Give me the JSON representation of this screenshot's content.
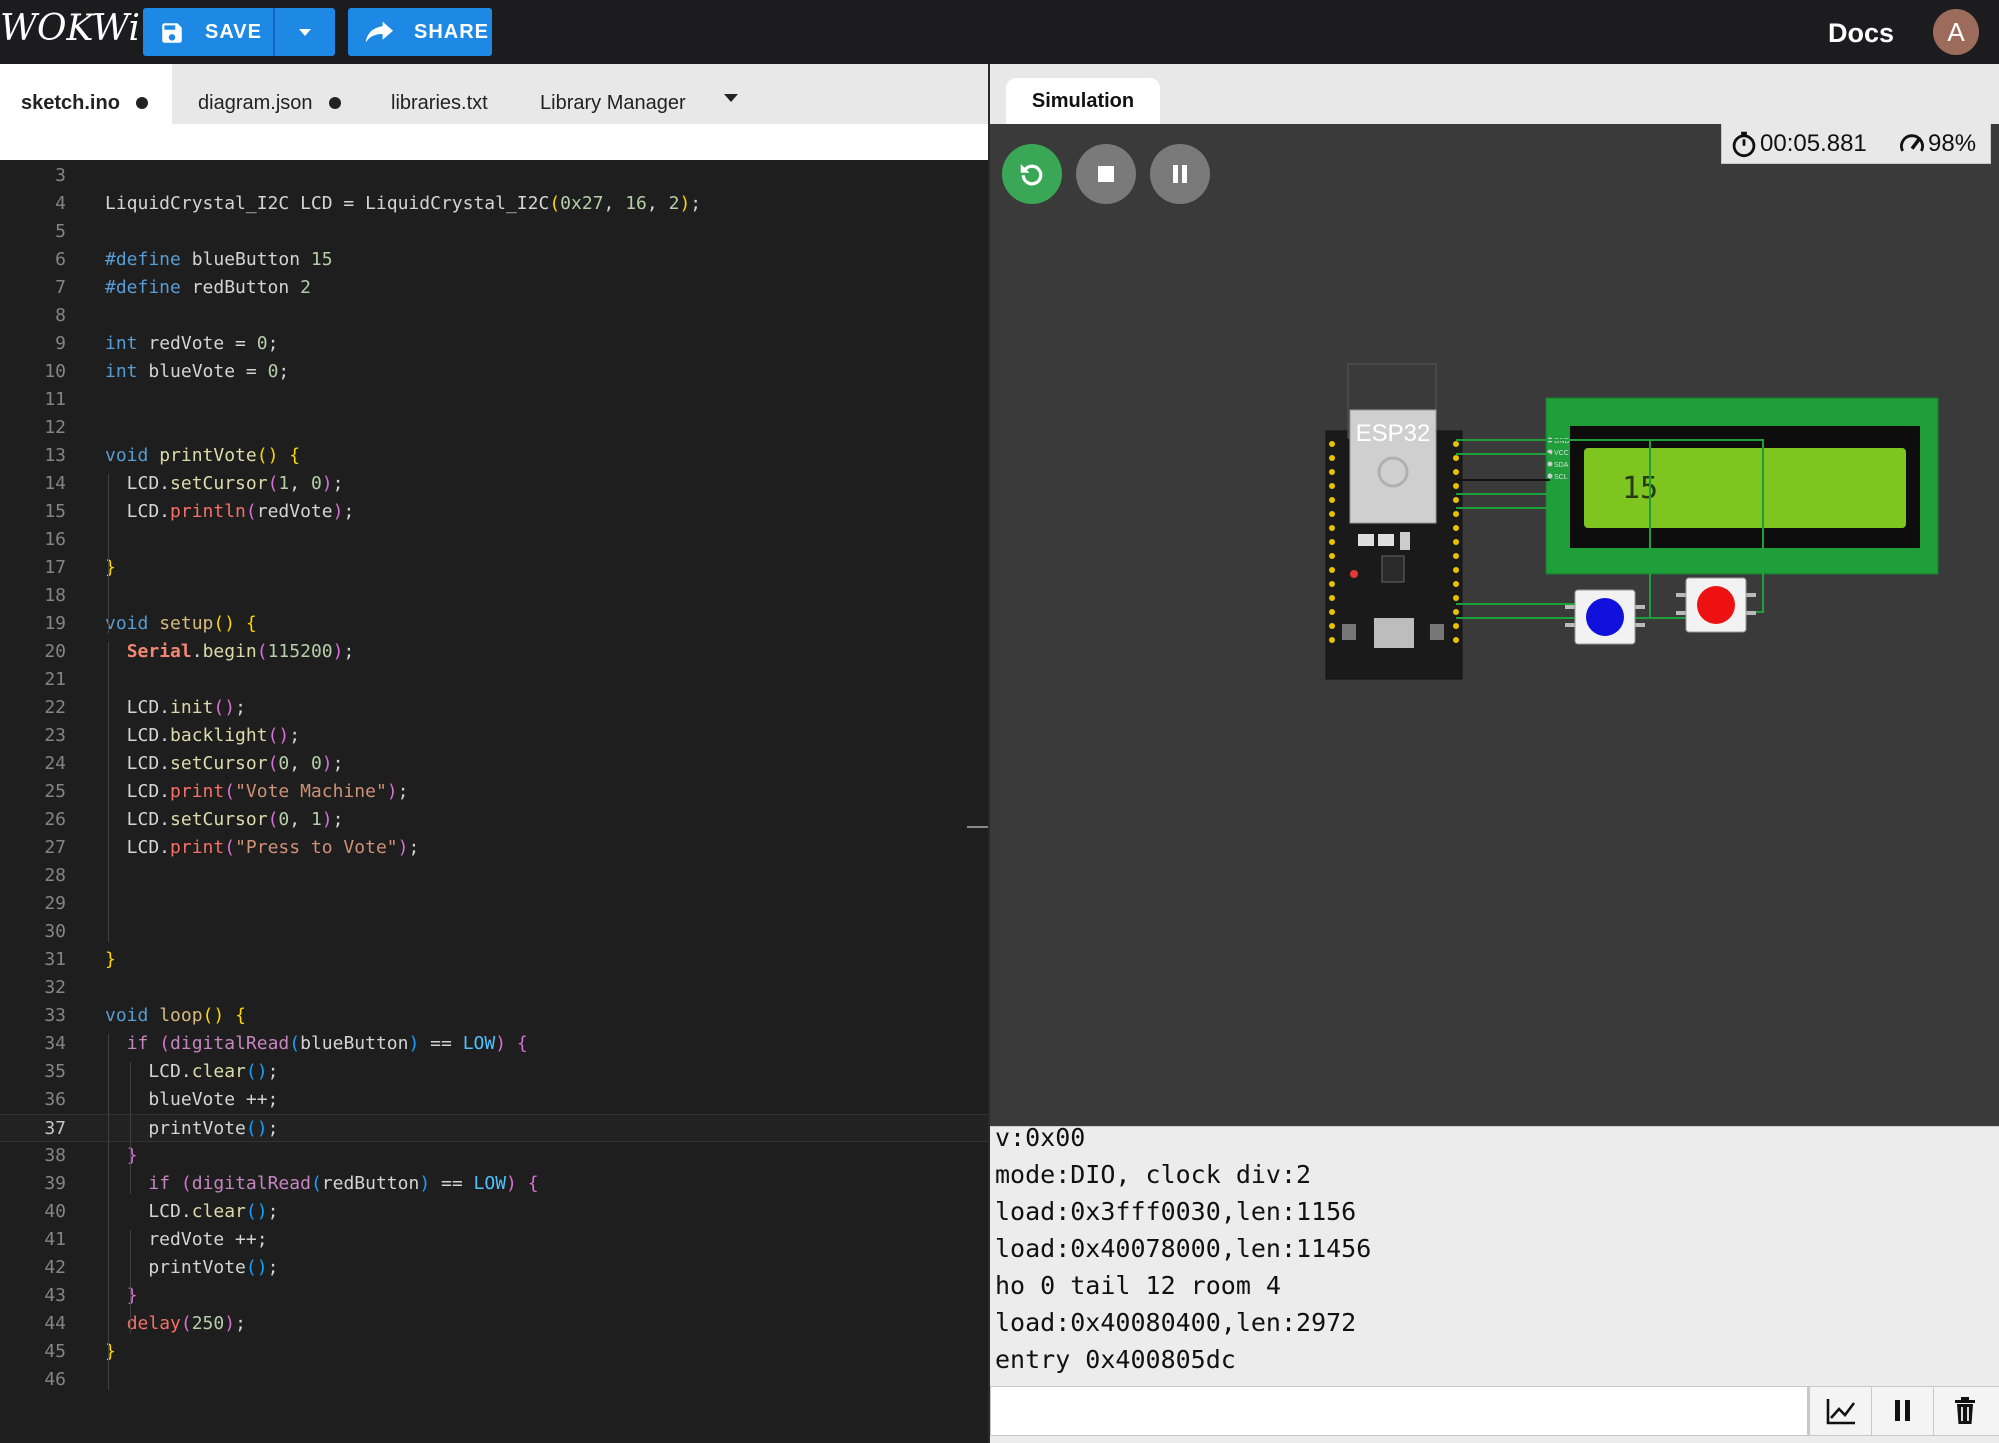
{
  "header": {
    "logo": "WOKWi",
    "save_label": "SAVE",
    "share_label": "SHARE",
    "docs_label": "Docs",
    "avatar_letter": "A"
  },
  "editor": {
    "tabs": [
      {
        "label": "sketch.ino",
        "modified": true,
        "active": true
      },
      {
        "label": "diagram.json",
        "modified": true,
        "active": false
      },
      {
        "label": "libraries.txt",
        "modified": false,
        "active": false
      },
      {
        "label": "Library Manager",
        "modified": false,
        "active": false
      }
    ],
    "active_line": 37,
    "lines": [
      {
        "n": "3",
        "tokens": [
          [
            "",
            ""
          ]
        ]
      },
      {
        "n": "4",
        "tokens": [
          [
            "LiquidCrystal_I2C LCD = LiquidCrystal_I2C",
            ""
          ],
          [
            "(",
            "brk"
          ],
          [
            "0x27",
            "num"
          ],
          [
            ", ",
            ""
          ],
          [
            "16",
            "num"
          ],
          [
            ", ",
            ""
          ],
          [
            "2",
            "num"
          ],
          [
            ")",
            "brk"
          ],
          [
            ";",
            ""
          ]
        ]
      },
      {
        "n": "5",
        "tokens": [
          [
            "",
            ""
          ]
        ]
      },
      {
        "n": "6",
        "tokens": [
          [
            "#define ",
            "kw"
          ],
          [
            "blueButton ",
            ""
          ],
          [
            "15",
            "num"
          ]
        ]
      },
      {
        "n": "7",
        "tokens": [
          [
            "#define ",
            "kw"
          ],
          [
            "redButton ",
            ""
          ],
          [
            "2",
            "num"
          ]
        ]
      },
      {
        "n": "8",
        "tokens": [
          [
            "",
            ""
          ]
        ]
      },
      {
        "n": "9",
        "tokens": [
          [
            "int ",
            "kw"
          ],
          [
            "redVote = ",
            ""
          ],
          [
            "0",
            "num"
          ],
          [
            ";",
            ""
          ]
        ]
      },
      {
        "n": "10",
        "tokens": [
          [
            "int ",
            "kw"
          ],
          [
            "blueVote = ",
            ""
          ],
          [
            "0",
            "num"
          ],
          [
            ";",
            ""
          ]
        ]
      },
      {
        "n": "11",
        "tokens": [
          [
            "",
            ""
          ]
        ]
      },
      {
        "n": "12",
        "tokens": [
          [
            "",
            ""
          ]
        ]
      },
      {
        "n": "13",
        "tokens": [
          [
            "void ",
            "kw"
          ],
          [
            "printVote",
            "fn"
          ],
          [
            "()",
            "brk"
          ],
          [
            " ",
            ""
          ],
          [
            "{",
            "brk"
          ]
        ]
      },
      {
        "n": "14",
        "tokens": [
          [
            "  LCD.",
            ""
          ],
          [
            "setCursor",
            "fn"
          ],
          [
            "(",
            "brk2"
          ],
          [
            "1",
            "num"
          ],
          [
            ", ",
            ""
          ],
          [
            "0",
            "num"
          ],
          [
            ")",
            "brk2"
          ],
          [
            ";",
            ""
          ]
        ]
      },
      {
        "n": "15",
        "tokens": [
          [
            "  LCD.",
            ""
          ],
          [
            "println",
            "print"
          ],
          [
            "(",
            "brk2"
          ],
          [
            "redVote",
            ""
          ],
          [
            ")",
            "brk2"
          ],
          [
            ";",
            ""
          ]
        ]
      },
      {
        "n": "16",
        "tokens": [
          [
            "",
            ""
          ]
        ]
      },
      {
        "n": "17",
        "tokens": [
          [
            "}",
            "brk"
          ]
        ]
      },
      {
        "n": "18",
        "tokens": [
          [
            "",
            ""
          ]
        ]
      },
      {
        "n": "19",
        "tokens": [
          [
            "void ",
            "kw"
          ],
          [
            "setup",
            "setup"
          ],
          [
            "()",
            "brk"
          ],
          [
            " ",
            ""
          ],
          [
            "{",
            "brk"
          ]
        ]
      },
      {
        "n": "20",
        "tokens": [
          [
            "  ",
            ""
          ],
          [
            "Serial",
            "serial"
          ],
          [
            ".",
            ""
          ],
          [
            "begin",
            "fn"
          ],
          [
            "(",
            "brk2"
          ],
          [
            "115200",
            "num"
          ],
          [
            ")",
            "brk2"
          ],
          [
            ";",
            ""
          ]
        ]
      },
      {
        "n": "21",
        "tokens": [
          [
            "",
            ""
          ]
        ]
      },
      {
        "n": "22",
        "tokens": [
          [
            "  LCD.",
            ""
          ],
          [
            "init",
            "fn"
          ],
          [
            "()",
            "brk2"
          ],
          [
            ";",
            ""
          ]
        ]
      },
      {
        "n": "23",
        "tokens": [
          [
            "  LCD.",
            ""
          ],
          [
            "backlight",
            "fn"
          ],
          [
            "()",
            "brk2"
          ],
          [
            ";",
            ""
          ]
        ]
      },
      {
        "n": "24",
        "tokens": [
          [
            "  LCD.",
            ""
          ],
          [
            "setCursor",
            "fn"
          ],
          [
            "(",
            "brk2"
          ],
          [
            "0",
            "num"
          ],
          [
            ", ",
            ""
          ],
          [
            "0",
            "num"
          ],
          [
            ")",
            "brk2"
          ],
          [
            ";",
            ""
          ]
        ]
      },
      {
        "n": "25",
        "tokens": [
          [
            "  LCD.",
            ""
          ],
          [
            "print",
            "print"
          ],
          [
            "(",
            "brk2"
          ],
          [
            "\"Vote Machine\"",
            "str"
          ],
          [
            ")",
            "brk2"
          ],
          [
            ";",
            ""
          ]
        ]
      },
      {
        "n": "26",
        "tokens": [
          [
            "  LCD.",
            ""
          ],
          [
            "setCursor",
            "fn"
          ],
          [
            "(",
            "brk2"
          ],
          [
            "0",
            "num"
          ],
          [
            ", ",
            ""
          ],
          [
            "1",
            "num"
          ],
          [
            ")",
            "brk2"
          ],
          [
            ";",
            ""
          ]
        ]
      },
      {
        "n": "27",
        "tokens": [
          [
            "  LCD.",
            ""
          ],
          [
            "print",
            "print"
          ],
          [
            "(",
            "brk2"
          ],
          [
            "\"Press to Vote\"",
            "str"
          ],
          [
            ")",
            "brk2"
          ],
          [
            ";",
            ""
          ]
        ]
      },
      {
        "n": "28",
        "tokens": [
          [
            "",
            ""
          ]
        ]
      },
      {
        "n": "29",
        "tokens": [
          [
            "",
            ""
          ]
        ]
      },
      {
        "n": "30",
        "tokens": [
          [
            "",
            ""
          ]
        ]
      },
      {
        "n": "31",
        "tokens": [
          [
            "}",
            "brk"
          ]
        ]
      },
      {
        "n": "32",
        "tokens": [
          [
            "",
            ""
          ]
        ]
      },
      {
        "n": "33",
        "tokens": [
          [
            "void ",
            "kw"
          ],
          [
            "loop",
            "setup"
          ],
          [
            "()",
            "brk"
          ],
          [
            " ",
            ""
          ],
          [
            "{",
            "brk"
          ]
        ]
      },
      {
        "n": "34",
        "tokens": [
          [
            "  ",
            ""
          ],
          [
            "if ",
            "fn2"
          ],
          [
            "(",
            "brk2"
          ],
          [
            "digitalRead",
            "fn2"
          ],
          [
            "(",
            "brk3"
          ],
          [
            "blueButton",
            ""
          ],
          [
            ")",
            "brk3"
          ],
          [
            " == ",
            ""
          ],
          [
            "LOW",
            "low"
          ],
          [
            ")",
            "brk2"
          ],
          [
            " ",
            ""
          ],
          [
            "{",
            "brk2"
          ]
        ]
      },
      {
        "n": "35",
        "tokens": [
          [
            "    LCD.",
            ""
          ],
          [
            "clear",
            "fn"
          ],
          [
            "()",
            "brk3"
          ],
          [
            ";",
            ""
          ]
        ]
      },
      {
        "n": "36",
        "tokens": [
          [
            "    blueVote ++;",
            ""
          ]
        ]
      },
      {
        "n": "37",
        "tokens": [
          [
            "    printVote",
            ""
          ],
          [
            "()",
            "brk3"
          ],
          [
            ";",
            ""
          ]
        ]
      },
      {
        "n": "38",
        "tokens": [
          [
            "  ",
            ""
          ],
          [
            "}",
            "brk2"
          ]
        ]
      },
      {
        "n": "39",
        "tokens": [
          [
            "    ",
            ""
          ],
          [
            "if ",
            "fn2"
          ],
          [
            "(",
            "brk2"
          ],
          [
            "digitalRead",
            "fn2"
          ],
          [
            "(",
            "brk3"
          ],
          [
            "redButton",
            ""
          ],
          [
            ")",
            "brk3"
          ],
          [
            " == ",
            ""
          ],
          [
            "LOW",
            "low"
          ],
          [
            ")",
            "brk2"
          ],
          [
            " ",
            ""
          ],
          [
            "{",
            "brk2"
          ]
        ]
      },
      {
        "n": "40",
        "tokens": [
          [
            "    LCD.",
            ""
          ],
          [
            "clear",
            "fn"
          ],
          [
            "()",
            "brk3"
          ],
          [
            ";",
            ""
          ]
        ]
      },
      {
        "n": "41",
        "tokens": [
          [
            "    redVote ++;",
            ""
          ]
        ]
      },
      {
        "n": "42",
        "tokens": [
          [
            "    printVote",
            ""
          ],
          [
            "()",
            "brk3"
          ],
          [
            ";",
            ""
          ]
        ]
      },
      {
        "n": "43",
        "tokens": [
          [
            "  ",
            ""
          ],
          [
            "}",
            "brk2"
          ]
        ]
      },
      {
        "n": "44",
        "tokens": [
          [
            "  ",
            ""
          ],
          [
            "delay",
            "print"
          ],
          [
            "(",
            "brk2"
          ],
          [
            "250",
            "num"
          ],
          [
            ")",
            "brk2"
          ],
          [
            ";",
            ""
          ]
        ]
      },
      {
        "n": "45",
        "tokens": [
          [
            "}",
            "brk"
          ]
        ]
      },
      {
        "n": "46",
        "tokens": [
          [
            "",
            ""
          ]
        ]
      }
    ]
  },
  "simulation": {
    "tab_label": "Simulation",
    "timer": "00:05.881",
    "speed": "98%",
    "esp32_label": "ESP32",
    "lcd_value": "15",
    "lcd_pins": [
      "GND",
      "VCC",
      "SDA",
      "SCL"
    ],
    "buttons": [
      {
        "name": "blue",
        "color": "#1111dd"
      },
      {
        "name": "red",
        "color": "#ee1111"
      }
    ]
  },
  "serial": {
    "lines": [
      "v:0x00",
      "mode:DIO, clock div:2",
      "load:0x3fff0030,len:1156",
      "load:0x40078000,len:11456",
      "ho 0 tail 12 room 4",
      "load:0x40080400,len:2972",
      "entry 0x400805dc"
    ],
    "input_value": ""
  },
  "colors": {
    "accent": "#1e88e5",
    "run_green": "#3aa757",
    "pcb_green": "#1f9e3a",
    "lcd_green": "#7ec51f"
  }
}
